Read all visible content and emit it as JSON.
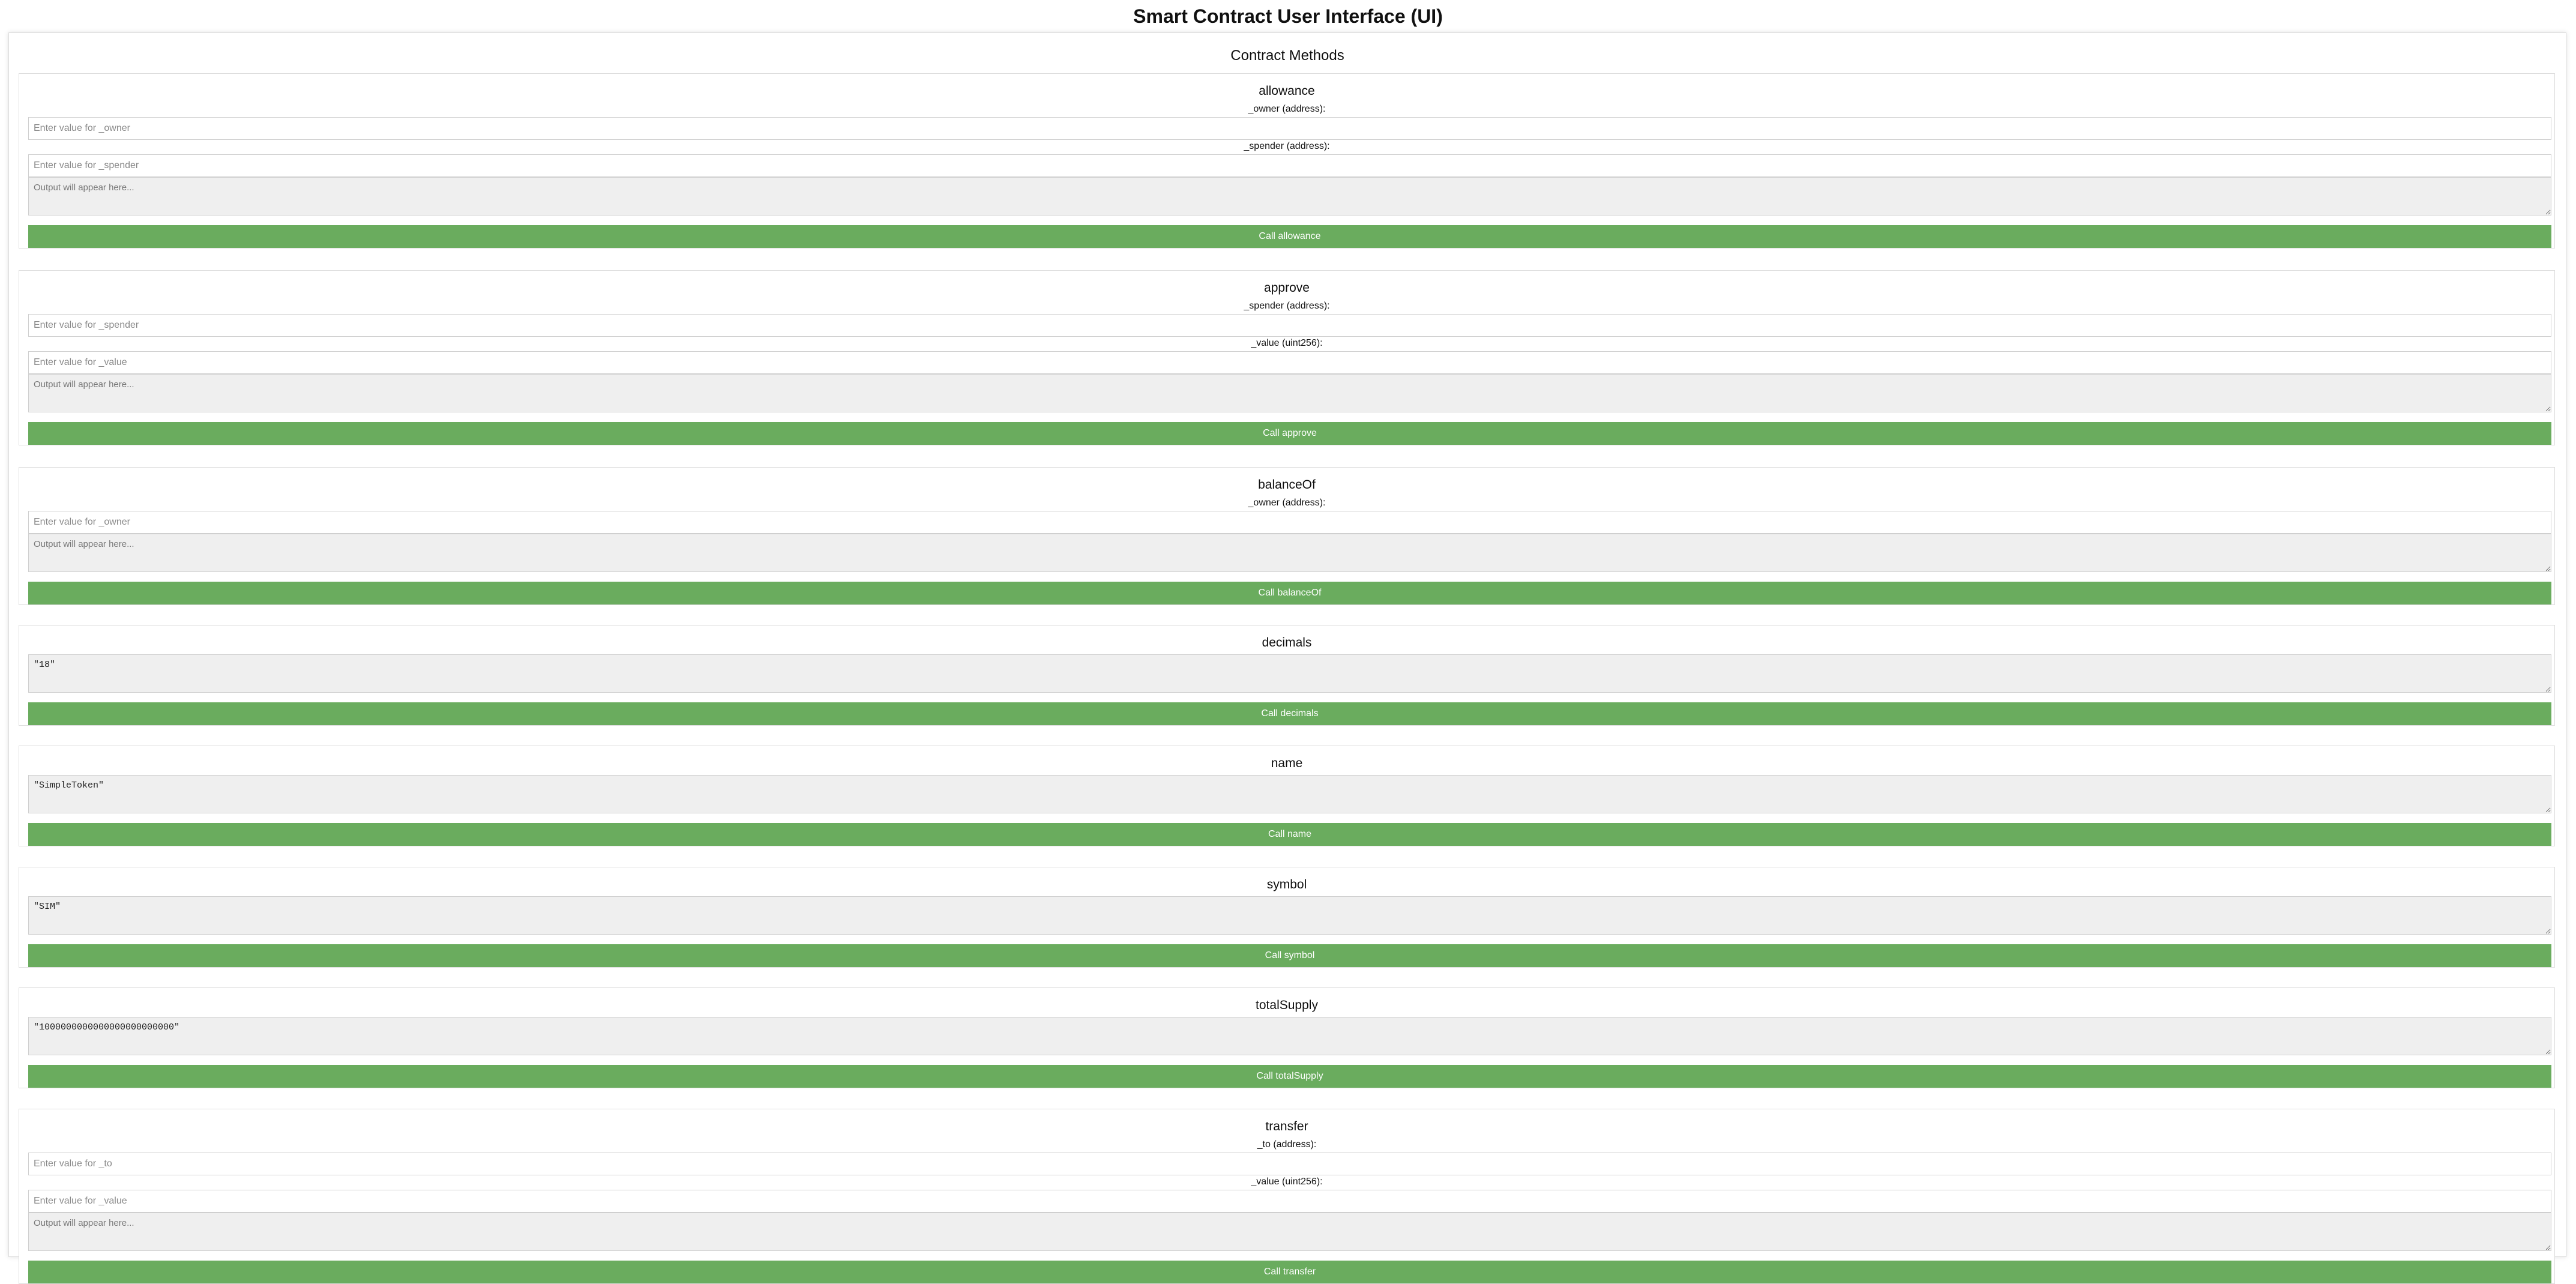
{
  "page": {
    "title": "Smart Contract User Interface (UI)",
    "panel_title": "Contract Methods",
    "output_placeholder": "Output will appear here...",
    "button_color": "#6aac5e"
  },
  "methods": [
    {
      "name": "allowance",
      "params": [
        {
          "label": "_owner (address):",
          "placeholder": "Enter value for _owner",
          "value": ""
        },
        {
          "label": "_spender (address):",
          "placeholder": "Enter value for _spender",
          "value": ""
        }
      ],
      "output": "",
      "button_label": "Call allowance"
    },
    {
      "name": "approve",
      "params": [
        {
          "label": "_spender (address):",
          "placeholder": "Enter value for _spender",
          "value": ""
        },
        {
          "label": "_value (uint256):",
          "placeholder": "Enter value for _value",
          "value": ""
        }
      ],
      "output": "",
      "button_label": "Call approve"
    },
    {
      "name": "balanceOf",
      "params": [
        {
          "label": "_owner (address):",
          "placeholder": "Enter value for _owner",
          "value": ""
        }
      ],
      "output": "",
      "button_label": "Call balanceOf"
    },
    {
      "name": "decimals",
      "params": [],
      "output": "\"18\"",
      "button_label": "Call decimals"
    },
    {
      "name": "name",
      "params": [],
      "output": "\"SimpleToken\"",
      "button_label": "Call name"
    },
    {
      "name": "symbol",
      "params": [],
      "output": "\"SIM\"",
      "button_label": "Call symbol"
    },
    {
      "name": "totalSupply",
      "params": [],
      "output": "\"1000000000000000000000000\"",
      "button_label": "Call totalSupply"
    },
    {
      "name": "transfer",
      "params": [
        {
          "label": "_to (address):",
          "placeholder": "Enter value for _to",
          "value": ""
        },
        {
          "label": "_value (uint256):",
          "placeholder": "Enter value for _value",
          "value": ""
        }
      ],
      "output": "",
      "button_label": "Call transfer"
    }
  ]
}
